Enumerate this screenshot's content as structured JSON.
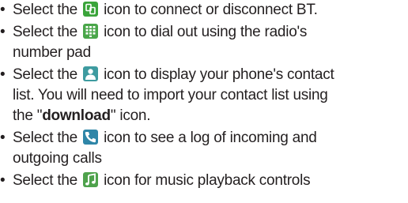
{
  "bullets": [
    {
      "pre": "Select the",
      "icon": "bluetooth-connect-icon",
      "post": "icon to connect or disconnect BT."
    },
    {
      "pre": "Select the",
      "icon": "number-pad-icon",
      "post": "icon to dial out using the radio's",
      "cont": "number pad"
    },
    {
      "pre": "Select the",
      "icon": "contact-person-icon",
      "post": "icon to display your phone's contact",
      "cont": "list. You will need to import your contact list using",
      "cont2_pre": "the \"",
      "cont2_bold": "download",
      "cont2_post": "\" icon."
    },
    {
      "pre": "Select the",
      "icon": "call-log-phone-icon",
      "post": "icon to see a log of incoming and",
      "cont": "outgoing calls"
    },
    {
      "pre": "Select the",
      "icon": "music-note-icon",
      "post": "icon for music playback controls"
    }
  ],
  "bullet_glyph": "•",
  "colors": {
    "text": "#231f20",
    "bt_icon": "#3aa43a",
    "pad_icon": "#4aa64a",
    "contact_icon": "#3e9ba0",
    "log_icon": "#2f86a8",
    "music_icon": "#4ea24c"
  }
}
